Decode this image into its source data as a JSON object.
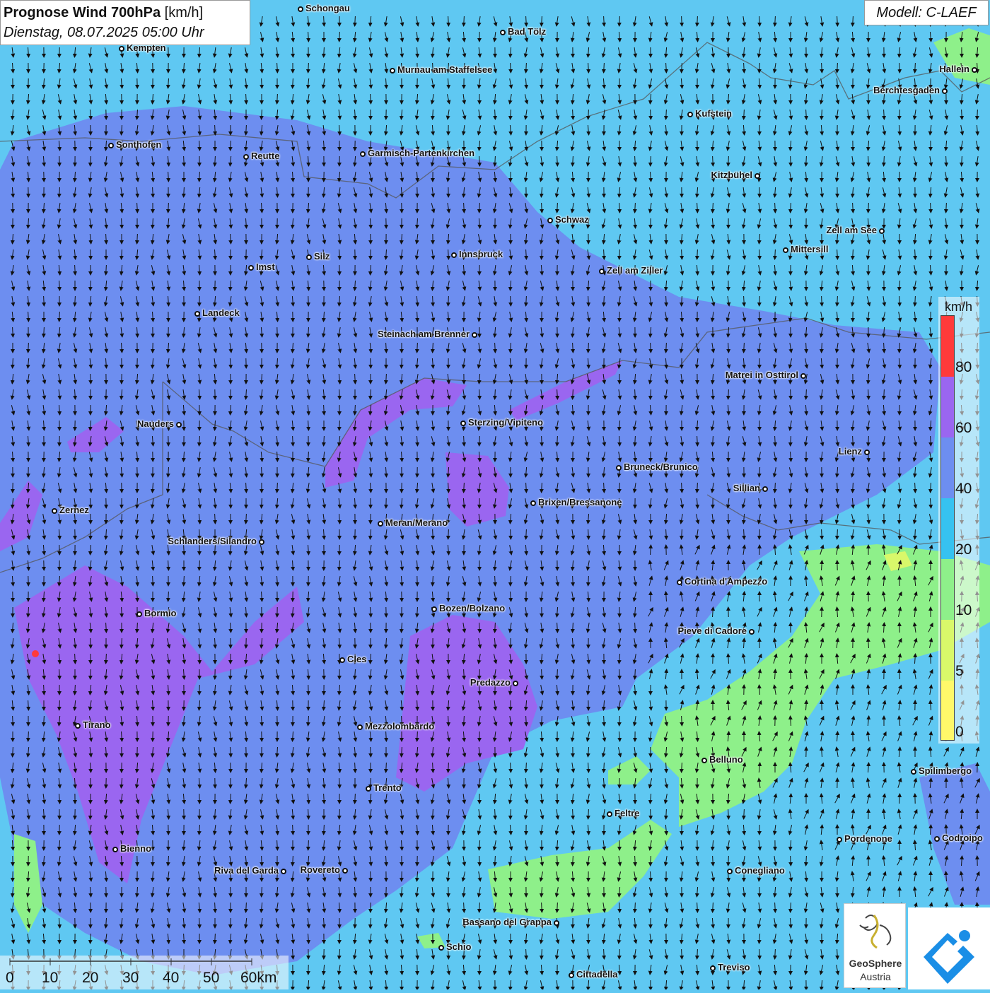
{
  "title": {
    "main": "Prognose Wind 700hPa",
    "unit": "[km/h]",
    "datetime": "Dienstag, 08.07.2025 05:00 Uhr"
  },
  "model": "Modell: C-LAEF",
  "colors": {
    "speed_0_5": "#fff86a",
    "speed_5_10": "#d9f86a",
    "speed_10_20": "#8ef08a",
    "speed_20_40": "#5fc8f2",
    "speed_40_60": "#6d8ef0",
    "speed_60_80": "#9a66f0",
    "speed_80_plus": "#ff3a3a"
  },
  "legend": {
    "unit": "km/h",
    "labels": [
      "80",
      "60",
      "40",
      "20",
      "10",
      "5",
      "0"
    ]
  },
  "scale_bar": {
    "labels": [
      "0",
      "10",
      "20",
      "30",
      "40",
      "50",
      "60km"
    ]
  },
  "cities": [
    "Schongau",
    "Bad Tölz",
    "Kempten",
    "Murnau am Staffelsee",
    "Hallein",
    "Berchtesgaden",
    "Kufstein",
    "Sonthofen",
    "Reutte",
    "Garmisch-Partenkirchen",
    "Kitzbühel",
    "Schwaz",
    "Zell am See",
    "Innsbruck",
    "Mittersill",
    "Imst",
    "Silz",
    "Zell am Ziller",
    "Landeck",
    "Steinach am Brenner",
    "Matrei in Osttirol",
    "Nauders",
    "Sterzing/Vipiteno",
    "Lienz",
    "Bruneck/Brunico",
    "Sillian",
    "Brixen/Bressanone",
    "Zernez",
    "Meran/Merano",
    "Schlanders/Silandro",
    "Cortina d'Ampezzo",
    "Bozen/Bolzano",
    "Bormio",
    "Pieve di Cadore",
    "Cles",
    "Predazzo",
    "Tirano",
    "Mezzolombardo",
    "Belluno",
    "Spilimbergo",
    "Trento",
    "Feltre",
    "Pordenone",
    "Codroipo",
    "Bienno",
    "Riva del Garda",
    "Rovereto",
    "Conegliano",
    "Bassano del Grappa",
    "Schio",
    "Treviso",
    "Cittadella"
  ],
  "logo": {
    "name1": "GeoSphere",
    "name2": "Austria"
  }
}
